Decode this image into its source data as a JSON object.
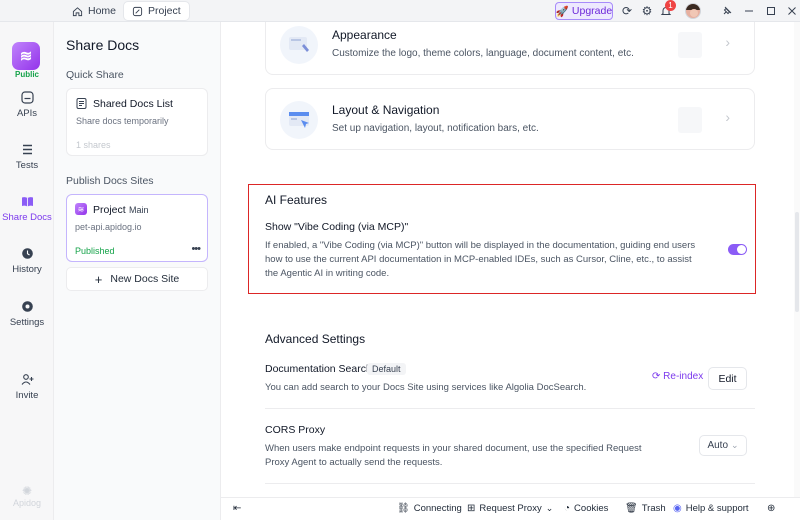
{
  "titlebar": {
    "tabs": [
      {
        "label": "Home",
        "icon": "home-icon"
      },
      {
        "label": "Project",
        "icon": "project-icon"
      }
    ],
    "upgrade_label": "Upgrade",
    "notification_count": "1"
  },
  "rail": {
    "badge": "Public",
    "items": [
      {
        "label": "APIs",
        "icon": "api-icon"
      },
      {
        "label": "Tests",
        "icon": "tests-icon"
      },
      {
        "label": "Share Docs",
        "icon": "share-docs-icon"
      },
      {
        "label": "History",
        "icon": "history-icon"
      },
      {
        "label": "Settings",
        "icon": "settings-icon"
      },
      {
        "label": "Invite",
        "icon": "invite-icon"
      }
    ],
    "footer": "Apidog"
  },
  "panel": {
    "title": "Share Docs",
    "quick_share_label": "Quick Share",
    "shared_list": {
      "title": "Shared Docs List",
      "subtitle": "Share docs temporarily",
      "meta": "1 shares"
    },
    "publish_label": "Publish Docs Sites",
    "site": {
      "name": "Project",
      "tag": "Main",
      "url": "pet-api.apidog.io",
      "status": "Published"
    },
    "new_site_label": "New Docs Site"
  },
  "main": {
    "cards": [
      {
        "title": "Appearance",
        "desc": "Customize the logo, theme colors, language, document content, etc."
      },
      {
        "title": "Layout & Navigation",
        "desc": "Set up navigation, layout, notification bars, etc."
      }
    ],
    "ai": {
      "title": "AI Features",
      "setting_title": "Show \"Vibe Coding (via MCP)\"",
      "setting_desc": "If enabled, a \"Vibe Coding (via MCP)\" button will be displayed in the documentation, guiding end users how to use the current API documentation in MCP-enabled IDEs, such as Cursor, Cline, etc., to assist the Agentic AI in writing code.",
      "enabled": true
    },
    "advanced": {
      "title": "Advanced Settings",
      "search": {
        "title": "Documentation Search",
        "tag": "Default",
        "desc": "You can add search to your Docs Site using services like Algolia DocSearch.",
        "reindex": "Re-index",
        "edit": "Edit"
      },
      "cors": {
        "title": "CORS Proxy",
        "desc": "When users make endpoint requests in your shared document, use the specified Request Proxy Agent to actually send the requests.",
        "value": "Auto"
      }
    }
  },
  "statusbar": {
    "connecting": "Connecting",
    "request_proxy": "Request Proxy",
    "cookies": "Cookies",
    "trash": "Trash",
    "help": "Help & support"
  }
}
